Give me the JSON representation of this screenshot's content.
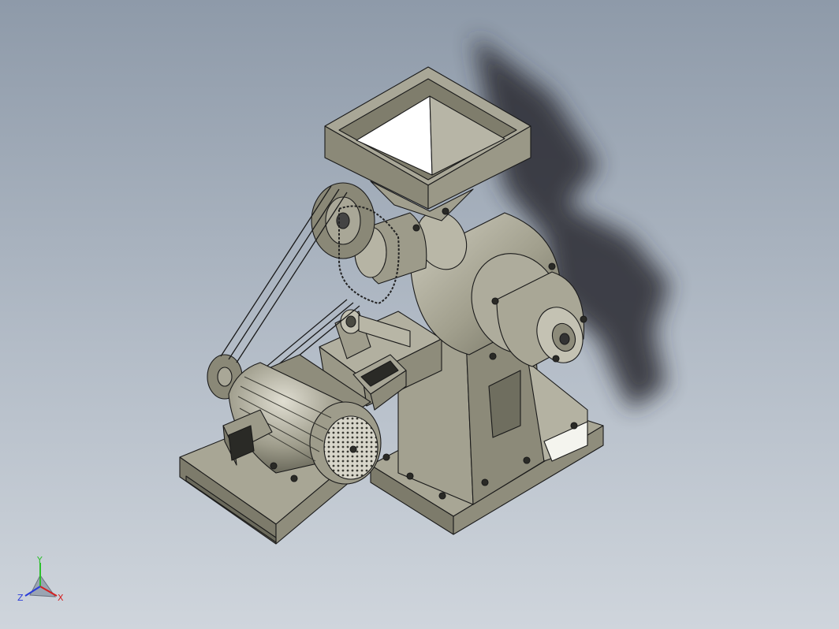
{
  "viewport": {
    "background_top": "#8e9aa9",
    "background_bottom": "#cfd5dc",
    "model_color": "#a5a391",
    "model_shade": "#7f7d6c",
    "edge_color": "#1a1a1a"
  },
  "triad": {
    "y_label": "Y",
    "z_label": "Z",
    "x_label": "X",
    "y_color": "#2bbf2b",
    "x_color": "#d42020",
    "z_color": "#2a3cd8"
  }
}
